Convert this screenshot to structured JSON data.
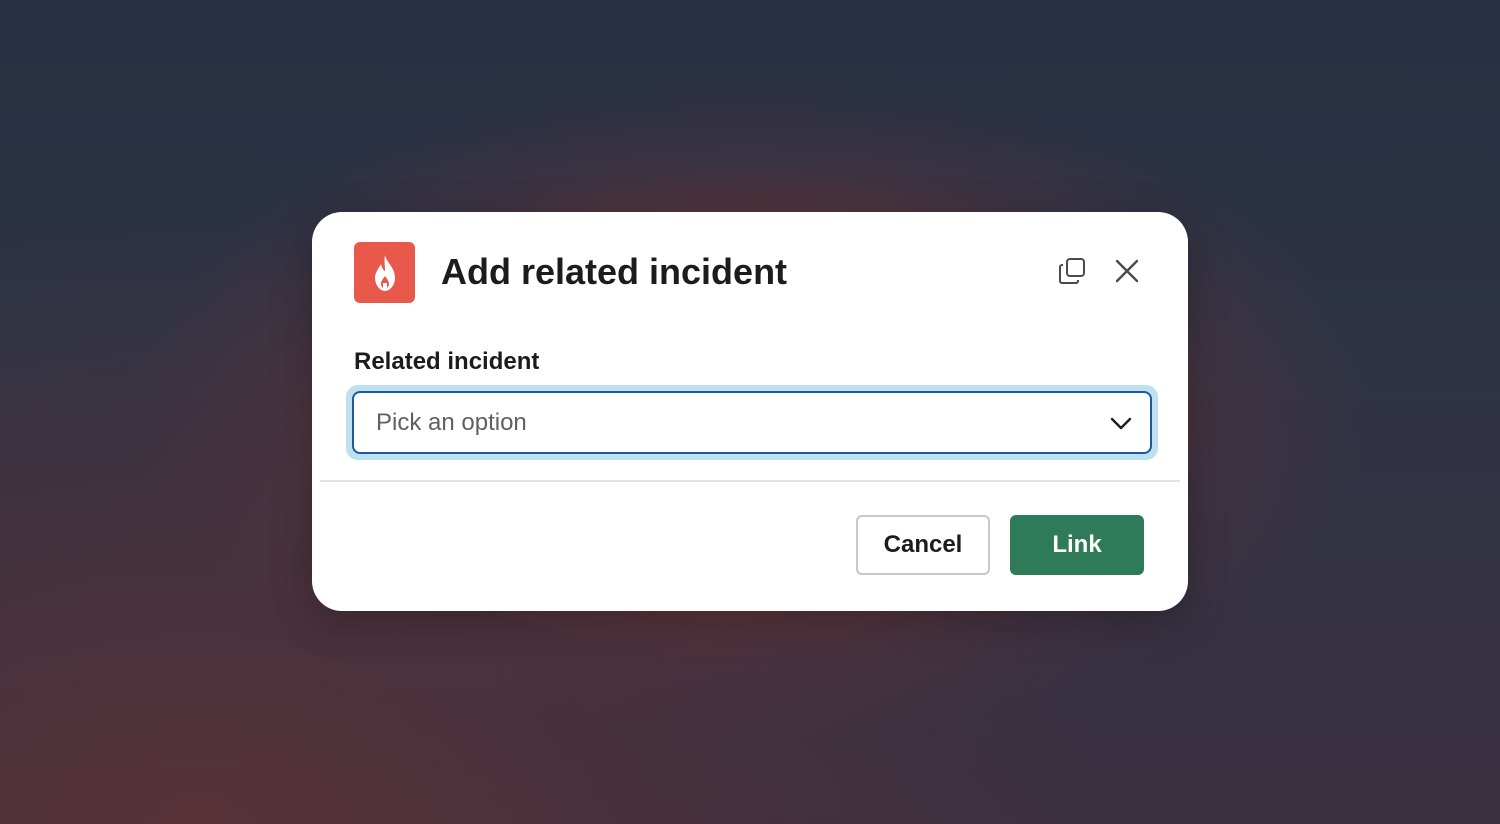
{
  "dialog": {
    "title": "Add related incident",
    "app_icon": "flame-icon",
    "app_icon_color": "#e8584b",
    "header_actions": [
      {
        "name": "copy-icon",
        "label": "Copy"
      },
      {
        "name": "close-icon",
        "label": "Close"
      }
    ]
  },
  "form": {
    "field_label": "Related incident",
    "select_placeholder": "Pick an option",
    "select_icon": "chevron-down-icon",
    "focus_ring_color": "#bfe0ef",
    "border_color": "#1b5aa0"
  },
  "footer": {
    "cancel_label": "Cancel",
    "submit_label": "Link",
    "submit_color": "#2f7a59"
  }
}
